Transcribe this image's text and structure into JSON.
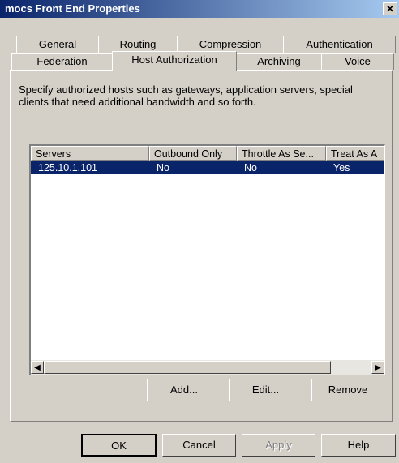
{
  "window": {
    "title": "mocs Front End Properties",
    "close_glyph": "✕"
  },
  "tabs_row1": [
    "General",
    "Routing",
    "Compression",
    "Authentication"
  ],
  "tabs_row2": [
    "Federation",
    "Host Authorization",
    "Archiving",
    "Voice"
  ],
  "active_tab": "Host Authorization",
  "description": "Specify authorized hosts such as gateways, application servers, special clients that need additional bandwidth and so forth.",
  "list": {
    "columns": [
      "Servers",
      "Outbound Only",
      "Throttle As Se...",
      "Treat As A"
    ],
    "rows": [
      {
        "server": "125.10.1.101",
        "outbound_only": "No",
        "throttle": "No",
        "treat_as": "Yes",
        "selected": true
      }
    ]
  },
  "list_buttons": {
    "add": "Add...",
    "edit": "Edit...",
    "remove": "Remove"
  },
  "dialog_buttons": {
    "ok": "OK",
    "cancel": "Cancel",
    "apply": "Apply",
    "help": "Help"
  },
  "colors": {
    "selection": "#0a246a",
    "title_start": "#0a246a",
    "title_end": "#a6caf0",
    "face": "#d4d0c8"
  }
}
